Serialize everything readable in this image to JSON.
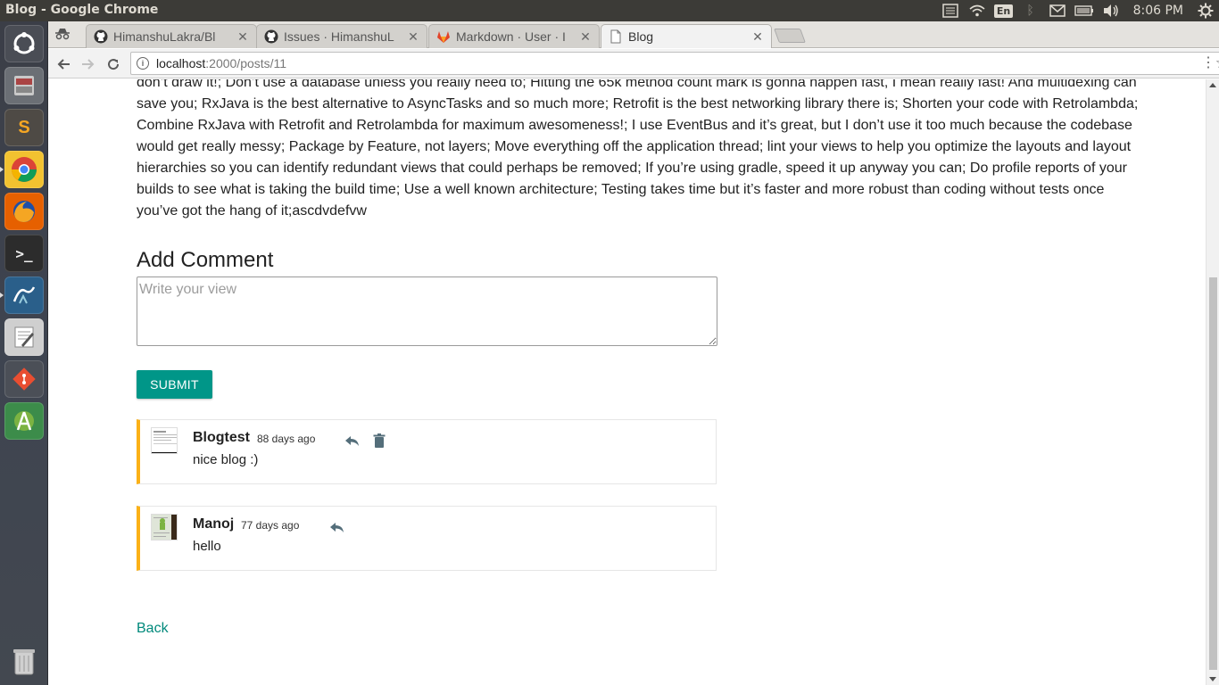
{
  "window": {
    "title": "Blog - Google Chrome"
  },
  "tray": {
    "lang": "En",
    "clock": "8:06 PM"
  },
  "tabs": [
    {
      "label": "HimanshuLakra/Bl",
      "icon": "github-icon"
    },
    {
      "label": "Issues · HimanshuL",
      "icon": "github-icon"
    },
    {
      "label": "Markdown · User · I",
      "icon": "gitlab-icon"
    },
    {
      "label": "Blog",
      "icon": "page-icon"
    }
  ],
  "address": {
    "host": "localhost",
    "path": ":2000/posts/11"
  },
  "post": {
    "body": "don’t draw it!; Don’t use a database unless you really need to; Hitting the 65k method count mark is gonna happen fast, I mean really fast! And multidexing can save you; RxJava is the best alternative to AsyncTasks and so much more; Retrofit is the best networking library there is; Shorten your code with Retrolambda; Combine RxJava with Retrofit and Retrolambda for maximum awesomeness!; I use EventBus and it’s great, but I don’t use it too much because the codebase would get really messy; Package by Feature, not layers; Move everything off the application thread; lint your views to help you optimize the layouts and layout hierarchies so you can identify redundant views that could perhaps be removed; If you’re using gradle, speed it up anyway you can; Do profile reports of your builds to see what is taking the build time; Use a well known architecture; Testing takes time but it’s faster and more robust than coding without tests once you’ve got the hang of it;ascdvdefvw"
  },
  "add_comment": {
    "title": "Add Comment",
    "placeholder": "Write your view",
    "submit_label": "SUBMIT"
  },
  "comments": [
    {
      "author": "Blogtest",
      "time": "88 days ago",
      "text": "nice blog :)",
      "can_delete": true
    },
    {
      "author": "Manoj",
      "time": "77 days ago",
      "text": "hello",
      "can_delete": false
    }
  ],
  "back_label": "Back",
  "colors": {
    "accent": "#009688",
    "comment_border": "#fbb117",
    "link": "#00897b"
  }
}
